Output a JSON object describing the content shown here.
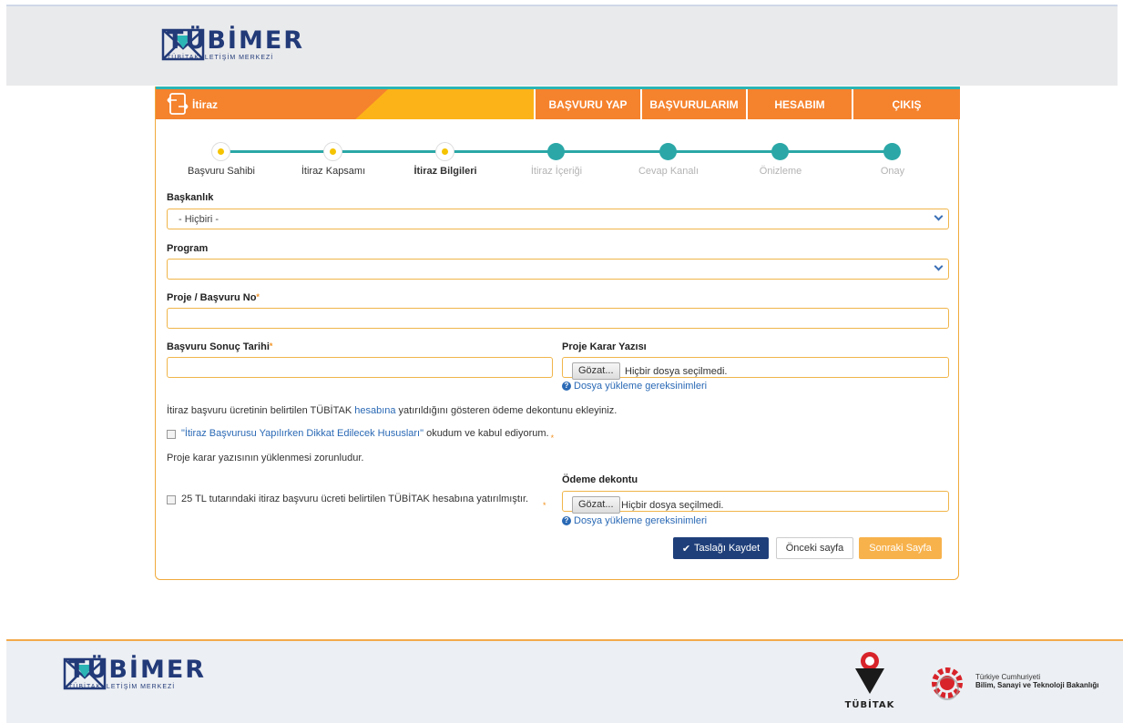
{
  "brand": {
    "name": "TÜBİMER",
    "subtitle": "TÜBİTAK İLETİŞİM MERKEZİ"
  },
  "page": {
    "title": "İtiraz"
  },
  "nav": [
    {
      "label": "BAŞVURU YAP"
    },
    {
      "label": "BAŞVURULARIM"
    },
    {
      "label": "HESABIM"
    },
    {
      "label": "ÇIKIŞ"
    }
  ],
  "steps": [
    {
      "label": "Başvuru Sahibi",
      "state": "done"
    },
    {
      "label": "İtiraz Kapsamı",
      "state": "done"
    },
    {
      "label": "İtiraz Bilgileri",
      "state": "active"
    },
    {
      "label": "İtiraz İçeriği",
      "state": "todo"
    },
    {
      "label": "Cevap Kanalı",
      "state": "todo"
    },
    {
      "label": "Önizleme",
      "state": "todo"
    },
    {
      "label": "Onay",
      "state": "todo"
    }
  ],
  "form": {
    "baskanlik": {
      "label": "Başkanlık",
      "value": "- Hiçbiri -"
    },
    "program": {
      "label": "Program",
      "value": ""
    },
    "proje_no": {
      "label": "Proje / Başvuru No",
      "required": "*",
      "value": ""
    },
    "sonuc_tarihi": {
      "label": "Başvuru Sonuç Tarihi",
      "required": "*",
      "value": ""
    },
    "karar_yazisi": {
      "label": "Proje Karar Yazısı",
      "button": "Gözat...",
      "file_text": "Hiçbir dosya seçilmedi.",
      "help": "Dosya yükleme gereksinimleri"
    },
    "dekont_note_pre": "İtiraz başvuru ücretinin belirtilen TÜBİTAK ",
    "dekont_note_link": "hesabına",
    "dekont_note_post": " yatırıldığını gösteren ödeme dekontunu ekleyiniz.",
    "hususlar_link": "\"İtiraz Başvurusu Yapılırken Dikkat Edilecek Hususları\"",
    "hususlar_text": " okudum ve kabul ediyorum.",
    "hususlar_req": "*",
    "karar_zorunlu": "Proje karar yazısının yüklenmesi zorunludur.",
    "ucret_text": "25 TL tutarındaki itiraz başvuru ücreti belirtilen TÜBİTAK hesabına yatırılmıştır.",
    "ucret_req": "*",
    "dekont": {
      "label": "Ödeme dekontu",
      "button": "Gözat...",
      "file_text": "Hiçbir dosya seçilmedi.",
      "help": "Dosya yükleme gereksinimleri"
    }
  },
  "actions": {
    "save": "Taslağı Kaydet",
    "prev": "Önceki sayfa",
    "next": "Sonraki Sayfa"
  },
  "footer": {
    "tubitak": "TÜBİTAK",
    "ministry_line1": "Türkiye Cumhuriyeti",
    "ministry_line2": "Bilim, Sanayi ve Teknoloji Bakanlığı"
  },
  "colors": {
    "orange": "#f5822d",
    "yellow": "#fcb318",
    "teal": "#2ba7a7",
    "navy": "#1f3f7a",
    "link": "#2a69b5"
  }
}
